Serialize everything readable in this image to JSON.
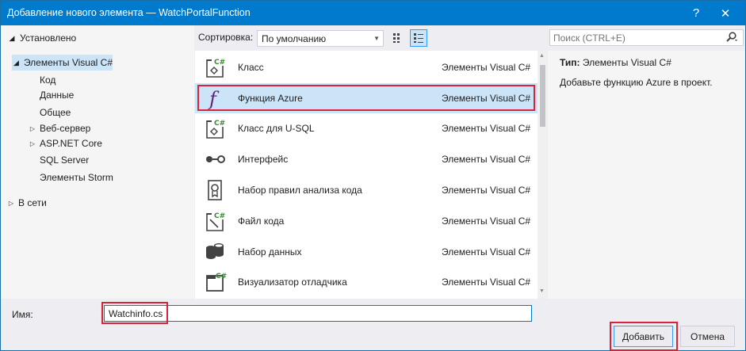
{
  "window": {
    "title": "Добавление нового элемента — WatchPortalFunction",
    "help": "?",
    "close": "✕"
  },
  "left_tree": [
    {
      "label": "Установлено",
      "arrow": "◢"
    },
    {
      "label": "Элементы Visual C#",
      "arrow": "◢"
    },
    {
      "label": "Код"
    },
    {
      "label": "Данные"
    },
    {
      "label": "Общее"
    },
    {
      "label": "Веб-сервер",
      "arrow": "▷"
    },
    {
      "label": "ASP.NET Core",
      "arrow": "▷"
    },
    {
      "label": "SQL Server"
    },
    {
      "label": "Элементы Storm"
    },
    {
      "label": "В сети",
      "arrow": "▷"
    }
  ],
  "toolbar": {
    "sort_label": "Сортировка:",
    "sort_value": "По умолчанию"
  },
  "search": {
    "placeholder": "Поиск (CTRL+E)"
  },
  "items": [
    {
      "name": "Класс",
      "category": "Элементы Visual C#",
      "icon": "class-icon"
    },
    {
      "name": "Функция Azure",
      "category": "Элементы Visual C#",
      "icon": "azure-function-icon"
    },
    {
      "name": "Класс для U-SQL",
      "category": "Элементы Visual C#",
      "icon": "usql-class-icon"
    },
    {
      "name": "Интерфейс",
      "category": "Элементы Visual C#",
      "icon": "interface-icon"
    },
    {
      "name": "Набор правил анализа кода",
      "category": "Элементы Visual C#",
      "icon": "ruleset-icon"
    },
    {
      "name": "Файл кода",
      "category": "Элементы Visual C#",
      "icon": "code-file-icon"
    },
    {
      "name": "Набор данных",
      "category": "Элементы Visual C#",
      "icon": "dataset-icon"
    },
    {
      "name": "Визуализатор отладчика",
      "category": "Элементы Visual C#",
      "icon": "debugger-visualizer-icon"
    }
  ],
  "details": {
    "type_label": "Тип:",
    "type_value": "Элементы Visual C#",
    "description": "Добавьте функцию Azure в проект."
  },
  "bottom": {
    "name_label": "Имя:",
    "name_value": "Watchinfo.cs",
    "add_button": "Добавить",
    "cancel_button": "Отмена"
  },
  "colors": {
    "accent": "#007acc",
    "highlight": "#d9233b",
    "selection": "#cce4f7"
  }
}
